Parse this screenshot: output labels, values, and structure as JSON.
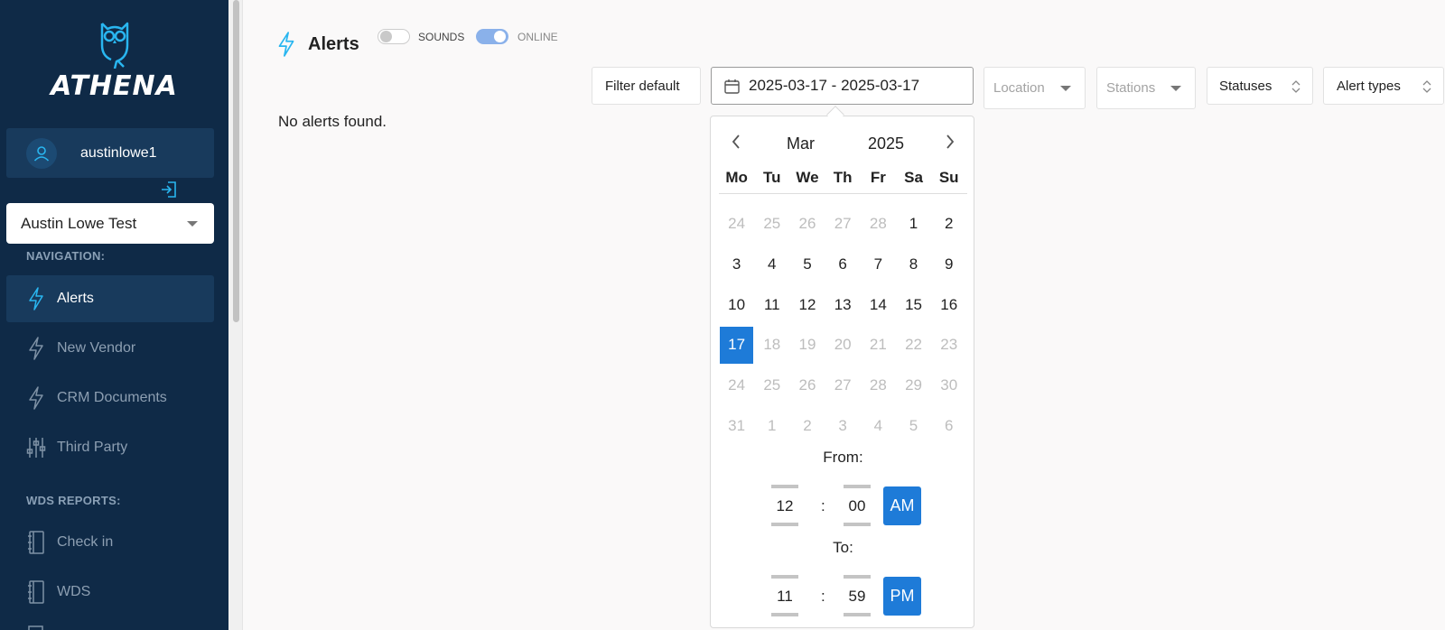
{
  "brand": {
    "name": "ATHENA"
  },
  "user": {
    "username": "austinlowe1"
  },
  "org_select": {
    "value": "Austin Lowe Test"
  },
  "sidebar": {
    "nav_section": "NAVIGATION:",
    "nav_items": [
      {
        "label": "Alerts",
        "icon": "bolt-icon",
        "active": true
      },
      {
        "label": "New Vendor",
        "icon": "bolt-icon"
      },
      {
        "label": "CRM Documents",
        "icon": "bolt-icon"
      },
      {
        "label": "Third Party",
        "icon": "sliders-icon"
      }
    ],
    "reports_section": "WDS REPORTS:",
    "report_items": [
      {
        "label": "Check in",
        "icon": "notebook-icon"
      },
      {
        "label": "WDS",
        "icon": "notebook-icon"
      }
    ]
  },
  "header": {
    "title": "Alerts",
    "sounds_label": "SOUNDS",
    "online_label": "ONLINE"
  },
  "toggles": {
    "sounds_on": false,
    "online_on": true
  },
  "filters": {
    "filter_default": "Filter default",
    "date_range": "2025-03-17 - 2025-03-17",
    "location_placeholder": "Location",
    "stations_placeholder": "Stations",
    "statuses": "Statuses",
    "alert_types": "Alert types"
  },
  "main": {
    "empty_message": "No alerts found."
  },
  "calendar": {
    "month": "Mar",
    "year": "2025",
    "weekdays": [
      "Mo",
      "Tu",
      "We",
      "Th",
      "Fr",
      "Sa",
      "Su"
    ],
    "days": [
      {
        "d": "24",
        "m": true
      },
      {
        "d": "25",
        "m": true
      },
      {
        "d": "26",
        "m": true
      },
      {
        "d": "27",
        "m": true
      },
      {
        "d": "28",
        "m": true
      },
      {
        "d": "1"
      },
      {
        "d": "2"
      },
      {
        "d": "3"
      },
      {
        "d": "4"
      },
      {
        "d": "5"
      },
      {
        "d": "6"
      },
      {
        "d": "7"
      },
      {
        "d": "8"
      },
      {
        "d": "9"
      },
      {
        "d": "10"
      },
      {
        "d": "11"
      },
      {
        "d": "12"
      },
      {
        "d": "13"
      },
      {
        "d": "14"
      },
      {
        "d": "15"
      },
      {
        "d": "16"
      },
      {
        "d": "17",
        "s": true
      },
      {
        "d": "18",
        "m": true
      },
      {
        "d": "19",
        "m": true
      },
      {
        "d": "20",
        "m": true
      },
      {
        "d": "21",
        "m": true
      },
      {
        "d": "22",
        "m": true
      },
      {
        "d": "23",
        "m": true
      },
      {
        "d": "24",
        "m": true
      },
      {
        "d": "25",
        "m": true
      },
      {
        "d": "26",
        "m": true
      },
      {
        "d": "27",
        "m": true
      },
      {
        "d": "28",
        "m": true
      },
      {
        "d": "29",
        "m": true
      },
      {
        "d": "30",
        "m": true
      },
      {
        "d": "31",
        "m": true
      },
      {
        "d": "1",
        "m": true
      },
      {
        "d": "2",
        "m": true
      },
      {
        "d": "3",
        "m": true
      },
      {
        "d": "4",
        "m": true
      },
      {
        "d": "5",
        "m": true
      },
      {
        "d": "6",
        "m": true
      }
    ],
    "from_label": "From:",
    "from": {
      "hour": "12",
      "minute": "00",
      "ampm": "AM"
    },
    "to_label": "To:",
    "to": {
      "hour": "11",
      "minute": "59",
      "ampm": "PM"
    }
  },
  "colors": {
    "sidebar_bg": "#0f2a47",
    "accent": "#1e7bd8",
    "logo_cyan": "#29b6f0"
  }
}
